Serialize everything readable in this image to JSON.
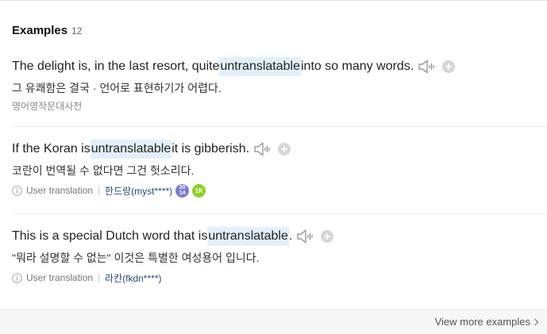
{
  "header": {
    "title": "Examples",
    "count": "12"
  },
  "examples": [
    {
      "en_before": "The delight is, in the last resort, quite ",
      "highlight": "untranslatable",
      "en_after": " into so many words.",
      "ko": "그 유쾌함은 결국 · 언어로 표현하기가 어렵다.",
      "source": "영어영작문대사전",
      "speaker_icon": "speaker-icon",
      "add_icon": "plus-circle-icon"
    },
    {
      "en_before": "If the Koran is ",
      "highlight": "untranslatable",
      "en_after": " it is gibberish.",
      "ko": "코란이 번역될 수 없다면 그건 헛소리다.",
      "meta_label": "User translation",
      "user": "한드랑(myst****)",
      "badge_a_top": "20",
      "badge_a_bottom": "14",
      "badge_b": "1K"
    },
    {
      "en_before": "This is a special Dutch word that is ",
      "highlight": "untranslatable",
      "en_after": ".",
      "ko": "\"뭐라 설명할 수 없는\" 이것은 특별한 여성용어 입니다.",
      "meta_label": "User translation",
      "user": "라칸(fkdn****)"
    }
  ],
  "footer": {
    "view_more": "View more examples"
  },
  "colors": {
    "highlight_bg": "#e3f0fb",
    "badge_purple": "#7b7bd6",
    "badge_green": "#8fcf25",
    "user_link": "#2a4a6b"
  }
}
